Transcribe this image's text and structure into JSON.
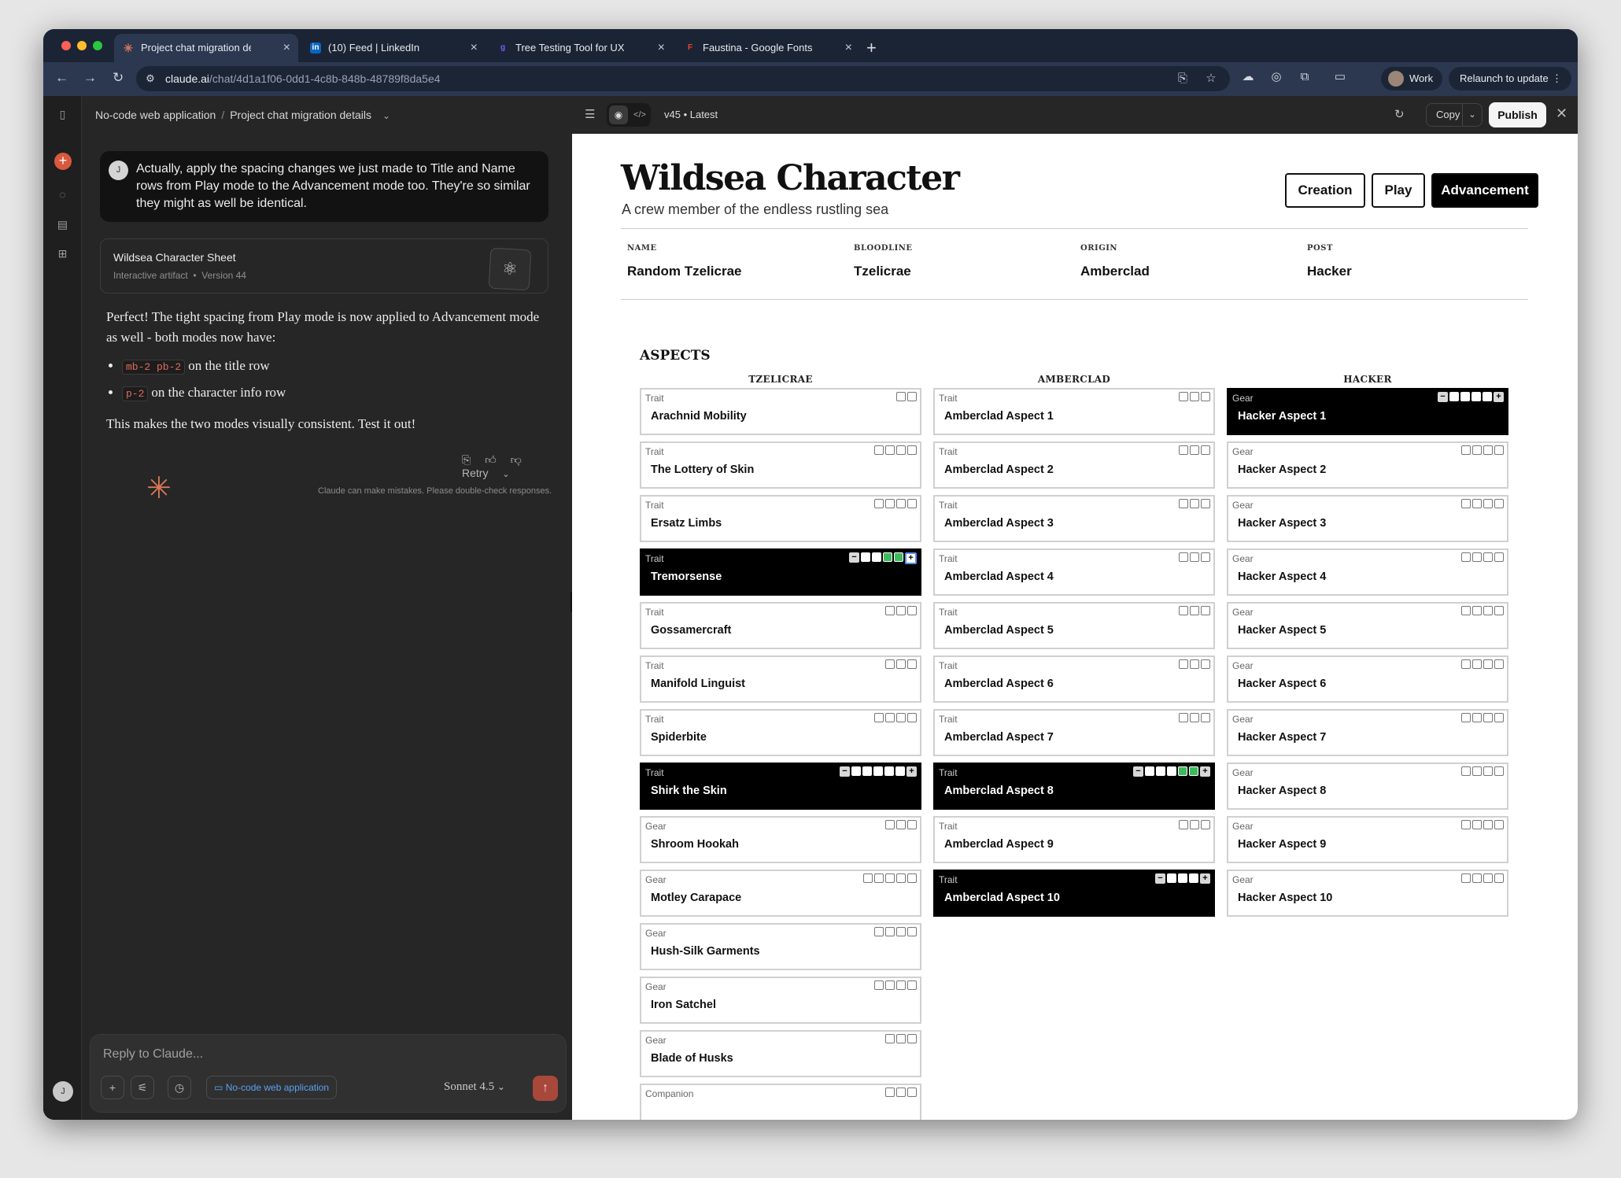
{
  "browser": {
    "tabs": [
      {
        "label": "Project chat migration details",
        "favicon": "claude-icon"
      },
      {
        "label": "(10) Feed | LinkedIn",
        "favicon": "linkedin-icon"
      },
      {
        "label": "Tree Testing Tool for UX Rese",
        "favicon": "treejack-icon"
      },
      {
        "label": "Faustina - Google Fonts",
        "favicon": "google-fonts-icon"
      }
    ],
    "url_host": "claude.ai",
    "url_path": "/chat/4d1a1f06-0dd1-4c8b-848b-48789f8da5e4",
    "profile": "Work",
    "relaunch": "Relaunch to update"
  },
  "chat": {
    "breadcrumb": {
      "project": "No-code web application",
      "chat": "Project chat migration details"
    },
    "user_initial": "J",
    "user_message": "Actually, apply the spacing changes we just made to Title and Name rows from Play mode to the Advancement mode too. They're so similar they might as well be identical.",
    "artifact": {
      "title": "Wildsea Character Sheet",
      "kind": "Interactive artifact",
      "version": "Version 44"
    },
    "reply": {
      "intro": "Perfect! The tight spacing from Play mode is now applied to Advancement mode as well - both modes now have:",
      "bullets": [
        {
          "code": "mb-2 pb-2",
          "text": "on the title row"
        },
        {
          "code": "p-2",
          "text": "on the character info row"
        }
      ],
      "outro": "This makes the two modes visually consistent. Test it out!"
    },
    "retry": "Retry",
    "disclaimer": "Claude can make mistakes. Please double-check responses.",
    "composer_placeholder": "Reply to Claude...",
    "project_chip": "No-code web application",
    "model": "Sonnet 4.5"
  },
  "preview": {
    "version": "v45 • Latest",
    "copy": "Copy",
    "publish": "Publish"
  },
  "sheet": {
    "title": "Wildsea Character",
    "subtitle": "A crew member of the endless rustling sea",
    "modes": [
      "Creation",
      "Play",
      "Advancement"
    ],
    "active_mode": "Advancement",
    "info": [
      {
        "key": "NAME",
        "value": "Random Tzelicrae"
      },
      {
        "key": "BLOODLINE",
        "value": "Tzelicrae"
      },
      {
        "key": "ORIGIN",
        "value": "Amberclad"
      },
      {
        "key": "POST",
        "value": "Hacker"
      }
    ],
    "aspects_heading": "ASPECTS",
    "columns": [
      {
        "name": "TZELICRAE",
        "cards": [
          {
            "type": "Trait",
            "name": "Arachnid Mobility",
            "track": 2,
            "marked": 0,
            "selected": false
          },
          {
            "type": "Trait",
            "name": "The Lottery of Skin",
            "track": 4,
            "marked": 0,
            "selected": false
          },
          {
            "type": "Trait",
            "name": "Ersatz Limbs",
            "track": 4,
            "marked": 0,
            "selected": false
          },
          {
            "type": "Trait",
            "name": "Tremorsense",
            "track": 4,
            "marked": 2,
            "selected": true
          },
          {
            "type": "Trait",
            "name": "Gossamercraft",
            "track": 3,
            "marked": 0,
            "selected": false
          },
          {
            "type": "Trait",
            "name": "Manifold Linguist",
            "track": 3,
            "marked": 0,
            "selected": false
          },
          {
            "type": "Trait",
            "name": "Spiderbite",
            "track": 4,
            "marked": 0,
            "selected": false
          },
          {
            "type": "Trait",
            "name": "Shirk the Skin",
            "track": 5,
            "marked": 0,
            "selected": true
          },
          {
            "type": "Gear",
            "name": "Shroom Hookah",
            "track": 3,
            "marked": 0,
            "selected": false
          },
          {
            "type": "Gear",
            "name": "Motley Carapace",
            "track": 5,
            "marked": 0,
            "selected": false
          },
          {
            "type": "Gear",
            "name": "Hush-Silk Garments",
            "track": 4,
            "marked": 0,
            "selected": false
          },
          {
            "type": "Gear",
            "name": "Iron Satchel",
            "track": 4,
            "marked": 0,
            "selected": false
          },
          {
            "type": "Gear",
            "name": "Blade of Husks",
            "track": 3,
            "marked": 0,
            "selected": false
          },
          {
            "type": "Companion",
            "name": "",
            "track": 3,
            "marked": 0,
            "selected": false
          }
        ]
      },
      {
        "name": "AMBERCLAD",
        "cards": [
          {
            "type": "Trait",
            "name": "Amberclad Aspect 1",
            "track": 3,
            "marked": 0,
            "selected": false
          },
          {
            "type": "Trait",
            "name": "Amberclad Aspect 2",
            "track": 3,
            "marked": 0,
            "selected": false
          },
          {
            "type": "Trait",
            "name": "Amberclad Aspect 3",
            "track": 3,
            "marked": 0,
            "selected": false
          },
          {
            "type": "Trait",
            "name": "Amberclad Aspect 4",
            "track": 3,
            "marked": 0,
            "selected": false
          },
          {
            "type": "Trait",
            "name": "Amberclad Aspect 5",
            "track": 3,
            "marked": 0,
            "selected": false
          },
          {
            "type": "Trait",
            "name": "Amberclad Aspect 6",
            "track": 3,
            "marked": 0,
            "selected": false
          },
          {
            "type": "Trait",
            "name": "Amberclad Aspect 7",
            "track": 3,
            "marked": 0,
            "selected": false
          },
          {
            "type": "Trait",
            "name": "Amberclad Aspect 8",
            "track": 5,
            "marked": 2,
            "selected": true
          },
          {
            "type": "Trait",
            "name": "Amberclad Aspect 9",
            "track": 3,
            "marked": 0,
            "selected": false
          },
          {
            "type": "Trait",
            "name": "Amberclad Aspect 10",
            "track": 3,
            "marked": 0,
            "selected": true
          }
        ]
      },
      {
        "name": "HACKER",
        "cards": [
          {
            "type": "Gear",
            "name": "Hacker Aspect 1",
            "track": 4,
            "marked": 0,
            "selected": true
          },
          {
            "type": "Gear",
            "name": "Hacker Aspect 2",
            "track": 4,
            "marked": 0,
            "selected": false
          },
          {
            "type": "Gear",
            "name": "Hacker Aspect 3",
            "track": 4,
            "marked": 0,
            "selected": false
          },
          {
            "type": "Gear",
            "name": "Hacker Aspect 4",
            "track": 4,
            "marked": 0,
            "selected": false
          },
          {
            "type": "Gear",
            "name": "Hacker Aspect 5",
            "track": 4,
            "marked": 0,
            "selected": false
          },
          {
            "type": "Gear",
            "name": "Hacker Aspect 6",
            "track": 4,
            "marked": 0,
            "selected": false
          },
          {
            "type": "Gear",
            "name": "Hacker Aspect 7",
            "track": 4,
            "marked": 0,
            "selected": false
          },
          {
            "type": "Gear",
            "name": "Hacker Aspect 8",
            "track": 4,
            "marked": 0,
            "selected": false
          },
          {
            "type": "Gear",
            "name": "Hacker Aspect 9",
            "track": 4,
            "marked": 0,
            "selected": false
          },
          {
            "type": "Gear",
            "name": "Hacker Aspect 10",
            "track": 4,
            "marked": 0,
            "selected": false
          }
        ]
      }
    ]
  },
  "colors": {
    "accent": "#d97757",
    "marked": "#3dbb5c",
    "selected_bg": "#000000",
    "window_chrome": "#1b2434"
  }
}
